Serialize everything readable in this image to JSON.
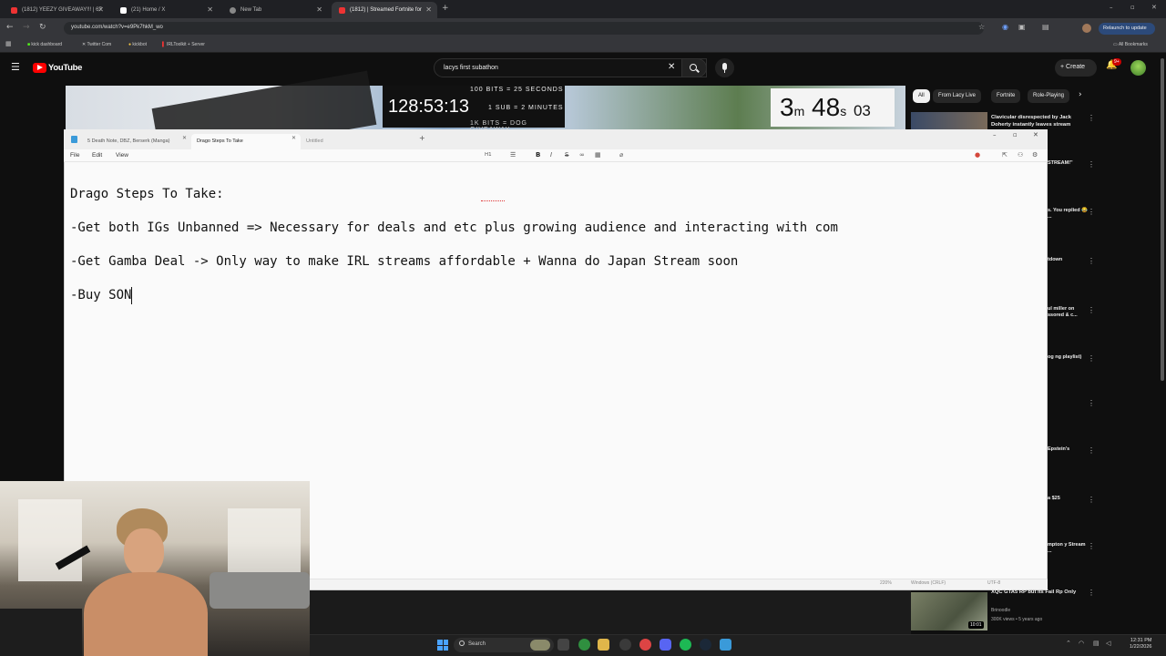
{
  "browser": {
    "tabs": [
      {
        "label": "(1812) YEEZY GIVEAWAY!!! | 67"
      },
      {
        "label": "(21) Home / X"
      },
      {
        "label": "New Tab"
      },
      {
        "label": "(1812) | Streamed Fortnite for"
      }
    ],
    "url": "youtube.com/watch?v=e9Pk7hkM_wo",
    "relaunch_label": "Relaunch to update",
    "bookmarks": [
      {
        "label": "kick dashboard"
      },
      {
        "label": "Twitter Com"
      },
      {
        "label": "kickbot"
      },
      {
        "label": "IRLToolkit + Server"
      }
    ],
    "all_bookmarks": "All Bookmarks"
  },
  "youtube": {
    "logo": "YouTube",
    "search_value": "lacys first subathon",
    "create_label": "Create",
    "notif_badge": "9+",
    "chips": [
      {
        "label": "All"
      },
      {
        "label": "From Lacy Live"
      },
      {
        "label": "Fortnite"
      },
      {
        "label": "Role-Playing"
      }
    ],
    "recommendations": [
      {
        "title": "Clavicular disrespected by Jack Doherty instantly leaves stream"
      },
      {
        "title": "STREAM!\""
      },
      {
        "title": "s. You replied 😂 ..."
      },
      {
        "title": "tdown"
      },
      {
        "title": "ul miller on ssored & c..."
      },
      {
        "title": "og ng playlist)"
      },
      {
        "title": "Epstein's"
      },
      {
        "title": "a $25"
      },
      {
        "title": "mpton y Stream ..."
      },
      {
        "title": "XQC GTA5 RP but its Fail Rp Only",
        "channel": "Brinoodle",
        "meta": "300K views • 5 years ago",
        "duration": "10:01"
      }
    ]
  },
  "stream_overlay": {
    "subathon_timer": "128:53:13",
    "line1": "100 BITS = 25 SECONDS",
    "line2": "1 SUB = 2 MINUTES",
    "line3": "1K BITS = DOG GIVEAWAY",
    "countdown_min": "3",
    "countdown_sec": "48",
    "countdown_ms": "03",
    "unit_m": "m",
    "unit_s": "s"
  },
  "notepad": {
    "tabs": [
      {
        "label": "5 Death Note, DBZ, Berserk (Manga)"
      },
      {
        "label": "Drago Steps To Take"
      },
      {
        "label": "Untitled"
      }
    ],
    "menu": {
      "file": "File",
      "edit": "Edit",
      "view": "View"
    },
    "heading_label": "H1",
    "lines": [
      "Drago Steps To Take:",
      "-Get both IGs Unbanned => Necessary for deals and etc plus growing audience and interacting with com",
      "-Get Gamba Deal -> Only way to make IRL streams affordable + Wanna do Japan Stream soon",
      "-Buy SON"
    ],
    "status": {
      "zoom": "220%",
      "line_ending": "Windows (CRLF)",
      "encoding": "UTF-8"
    }
  },
  "taskbar": {
    "search_placeholder": "Search",
    "time": "12:31 PM",
    "date": "1/22/2026"
  }
}
